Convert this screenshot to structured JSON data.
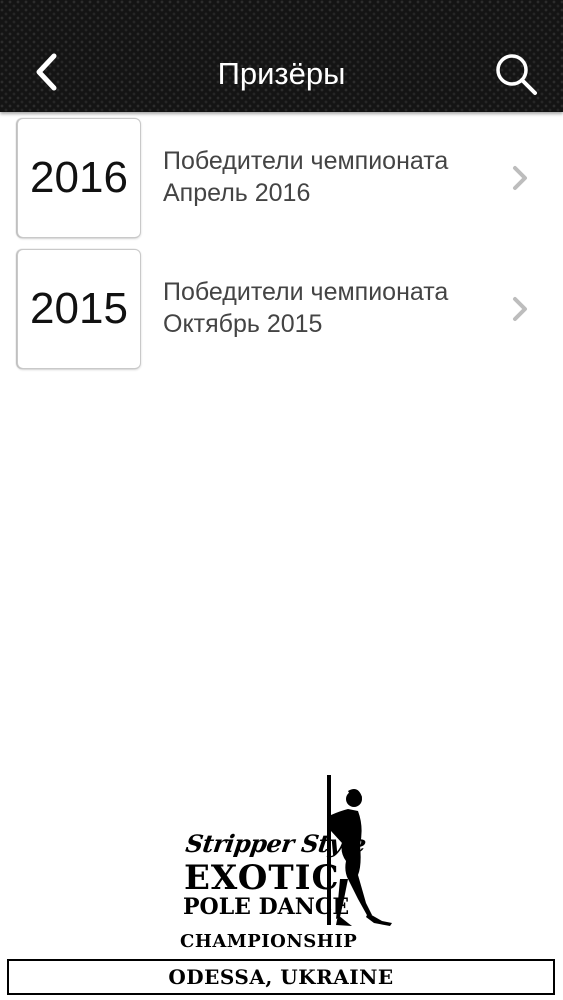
{
  "header": {
    "title": "Призёры"
  },
  "items": [
    {
      "year": "2016",
      "line1": "Победители чемпионата",
      "line2": "Апрель 2016"
    },
    {
      "year": "2015",
      "line1": "Победители чемпионата",
      "line2": "Октябрь 2015"
    }
  ],
  "logo": {
    "script": "Stripper Style",
    "line1": "EXOTIC",
    "line2": "POLE DANCE",
    "line3": "CHAMPIONSHIP",
    "city": "ODESSA, UKRAINE"
  },
  "icons": {
    "back": "chevron-left-icon",
    "search": "search-icon",
    "row_arrow": "chevron-right-icon"
  },
  "colors": {
    "header_bg": "#141414",
    "title_text": "#ffffff",
    "row_text": "#444444",
    "chevron": "#bdbdbd"
  }
}
